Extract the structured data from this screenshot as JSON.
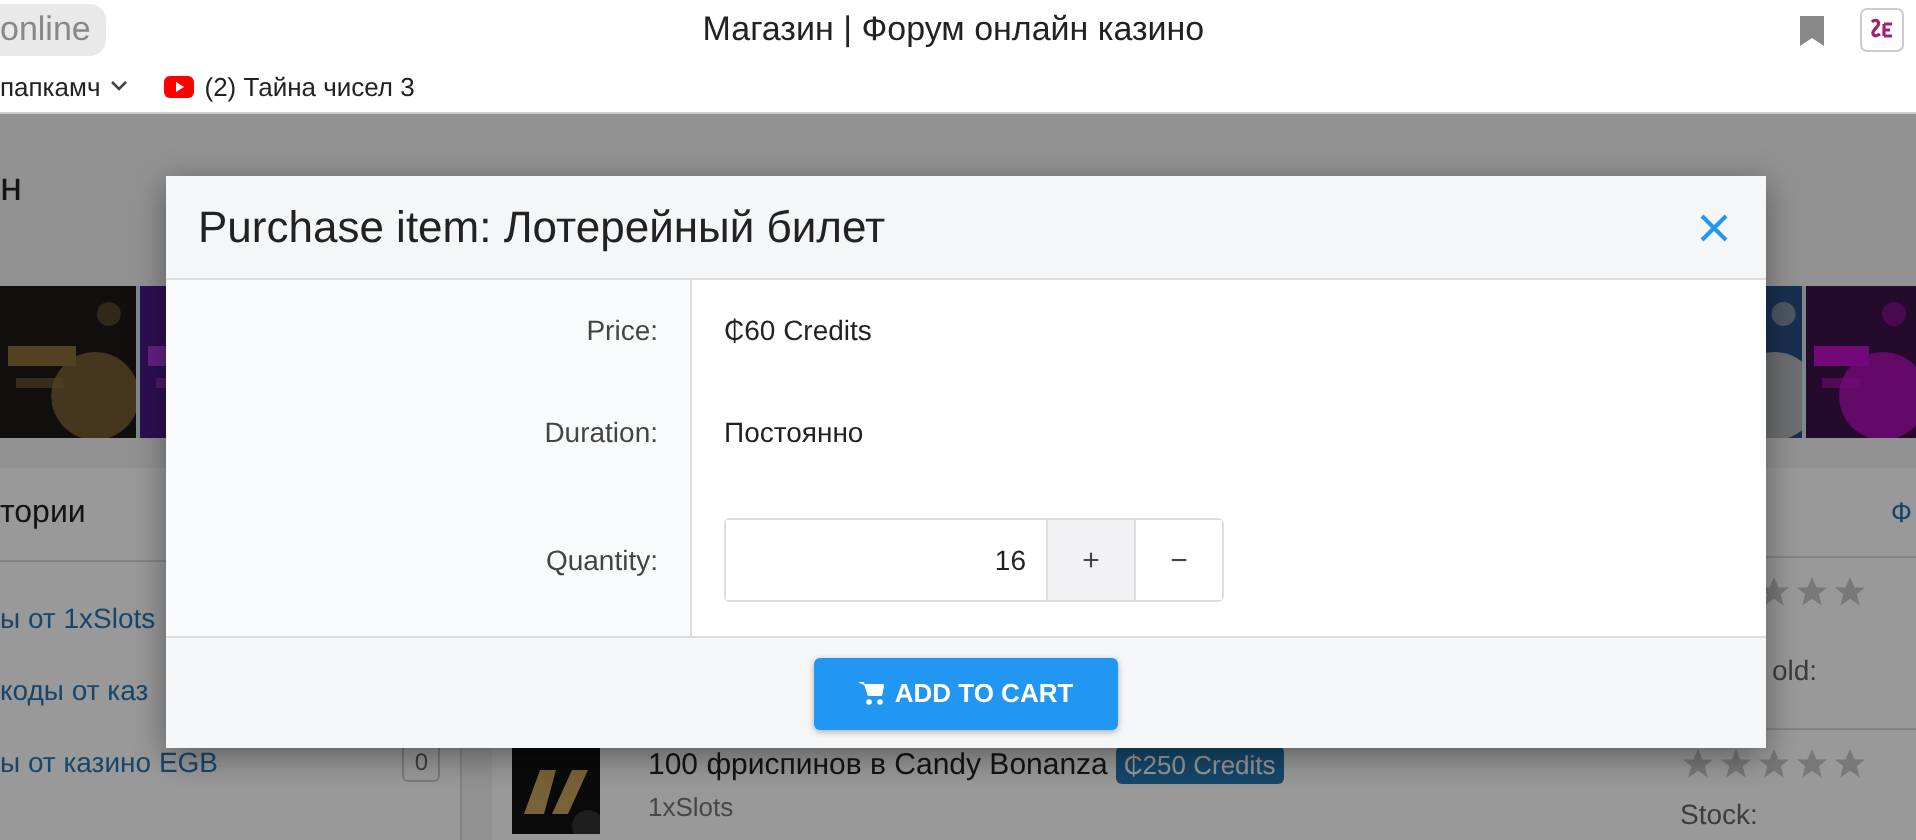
{
  "browser": {
    "tab": "online",
    "title": "Магазин | Форум онлайн казино",
    "bookmarks": [
      {
        "kind": "folder",
        "label": "папкамч"
      },
      {
        "kind": "video",
        "label": "(2) Тайна чисел 3"
      }
    ]
  },
  "page": {
    "heading": "н",
    "categories": {
      "title": "тории",
      "items": [
        {
          "label": "ы от 1xSlots"
        },
        {
          "label": "коды от каз"
        },
        {
          "label": "ы от казино EGB",
          "count": "0"
        }
      ]
    },
    "list": {
      "link": "Ф",
      "items": [
        {
          "stars": 0,
          "meta": "old:"
        },
        {
          "title": "100 фриспинов в Candy Bonanza",
          "price": "₵250 Credits",
          "vendor": "1xSlots",
          "stars": 0,
          "meta": "Stock:"
        }
      ]
    }
  },
  "dialog": {
    "title": "Purchase item: Лотерейный билет",
    "fields": [
      {
        "kind": "text",
        "label": "Price:",
        "value": "₵60 Credits"
      },
      {
        "kind": "text",
        "label": "Duration:",
        "value": "Постоянно"
      },
      {
        "kind": "quantity",
        "label": "Quantity:",
        "value": "16",
        "buttons": [
          "+",
          "−"
        ]
      }
    ],
    "button": "ADD TO CART"
  }
}
